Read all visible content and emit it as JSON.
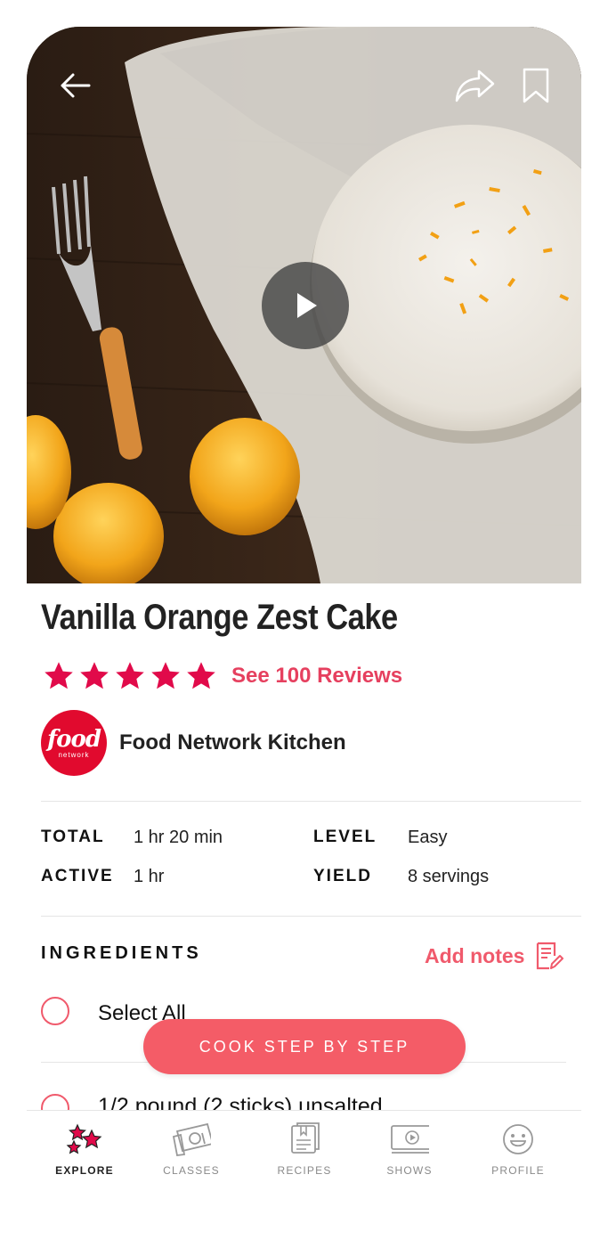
{
  "recipe": {
    "title": "Vanilla Orange Zest Cake",
    "rating_stars": 5,
    "reviews_label": "See 100 Reviews",
    "source_logo_line1": "food",
    "source_logo_line2": "network",
    "source_name": "Food Network Kitchen"
  },
  "meta": {
    "total_label": "TOTAL",
    "total_value": "1 hr 20 min",
    "active_label": "ACTIVE",
    "active_value": "1 hr",
    "level_label": "LEVEL",
    "level_value": "Easy",
    "yield_label": "YIELD",
    "yield_value": "8 servings"
  },
  "ingredients": {
    "heading": "INGREDIENTS",
    "add_notes_label": "Add notes",
    "select_all_label": "Select All",
    "items": [
      "1/2 pound (2 sticks) unsalted"
    ]
  },
  "cook_button_label": "COOK STEP BY STEP",
  "tabs": [
    {
      "label": "EXPLORE",
      "icon": "stars-icon",
      "active": true
    },
    {
      "label": "CLASSES",
      "icon": "classes-icon",
      "active": false
    },
    {
      "label": "RECIPES",
      "icon": "recipes-icon",
      "active": false
    },
    {
      "label": "SHOWS",
      "icon": "shows-icon",
      "active": false
    },
    {
      "label": "PROFILE",
      "icon": "smiley-icon",
      "active": false
    }
  ],
  "colors": {
    "accent": "#e6405f",
    "button": "#f45c67",
    "brand_red": "#e10a2e"
  }
}
